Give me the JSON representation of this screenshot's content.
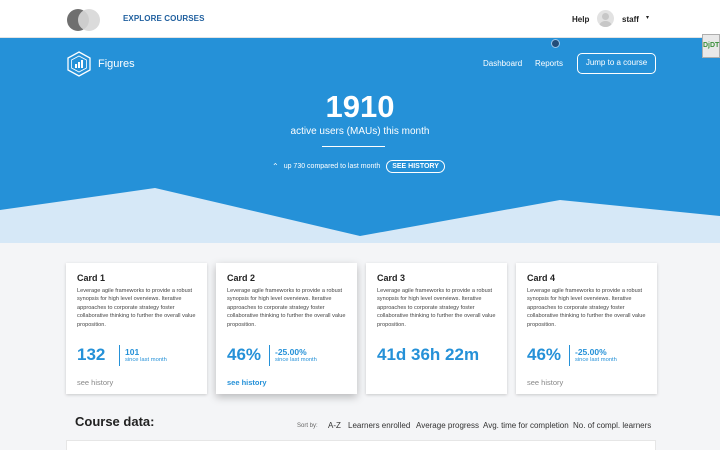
{
  "header": {
    "explore_label": "EXPLORE COURSES",
    "help_label": "Help",
    "username": "staff",
    "caret": "▾",
    "side_tab_label": "DjDT"
  },
  "hero": {
    "brand_name": "Figures",
    "nav": {
      "dashboard": "Dashboard",
      "reports": "Reports",
      "jump_button": "Jump to a course"
    },
    "active_users_count": "1910",
    "active_users_label": "active users (MAUs) this month",
    "up_icon": "⌃",
    "trend_text": "up 730 compared to last month",
    "history_button": "SEE HISTORY"
  },
  "cards": [
    {
      "title": "Card 1",
      "description": "Leverage agile frameworks to provide a robust synopsis for high level overviews. Iterative approaches to corporate strategy foster collaborative thinking to further the overall value proposition.",
      "metric": "132",
      "delta": "101",
      "since": "since last month",
      "link": "see history"
    },
    {
      "title": "Card 2",
      "description": "Leverage agile frameworks to provide a robust synopsis for high level overviews. Iterative approaches to corporate strategy foster collaborative thinking to further the overall value proposition.",
      "metric": "46%",
      "delta": "-25.00%",
      "since": "since last month",
      "link": "see history"
    },
    {
      "title": "Card 3",
      "description": "Leverage agile frameworks to provide a robust synopsis for high level overviews. Iterative approaches to corporate strategy foster collaborative thinking to further the overall value proposition.",
      "metric": "41d 36h 22m"
    },
    {
      "title": "Card 4",
      "description": "Leverage agile frameworks to provide a robust synopsis for high level overviews. Iterative approaches to corporate strategy foster collaborative thinking to further the overall value proposition.",
      "metric": "46%",
      "delta": "-25.00%",
      "since": "since last month",
      "link": "see history"
    }
  ],
  "course_data": {
    "title": "Course data:",
    "sort_label": "Sort by:",
    "sort_options": [
      "A-Z",
      "Learners enrolled",
      "Average progress",
      "Avg. time for completion",
      "No. of compl. learners"
    ]
  },
  "colors": {
    "hero_blue": "#2591d8",
    "wave_light": "#d6e8f7",
    "link_blue": "#1f5f9e"
  },
  "icons": [
    "figures-logo-icon",
    "avatar-icon",
    "chevron-up-double-icon"
  ]
}
